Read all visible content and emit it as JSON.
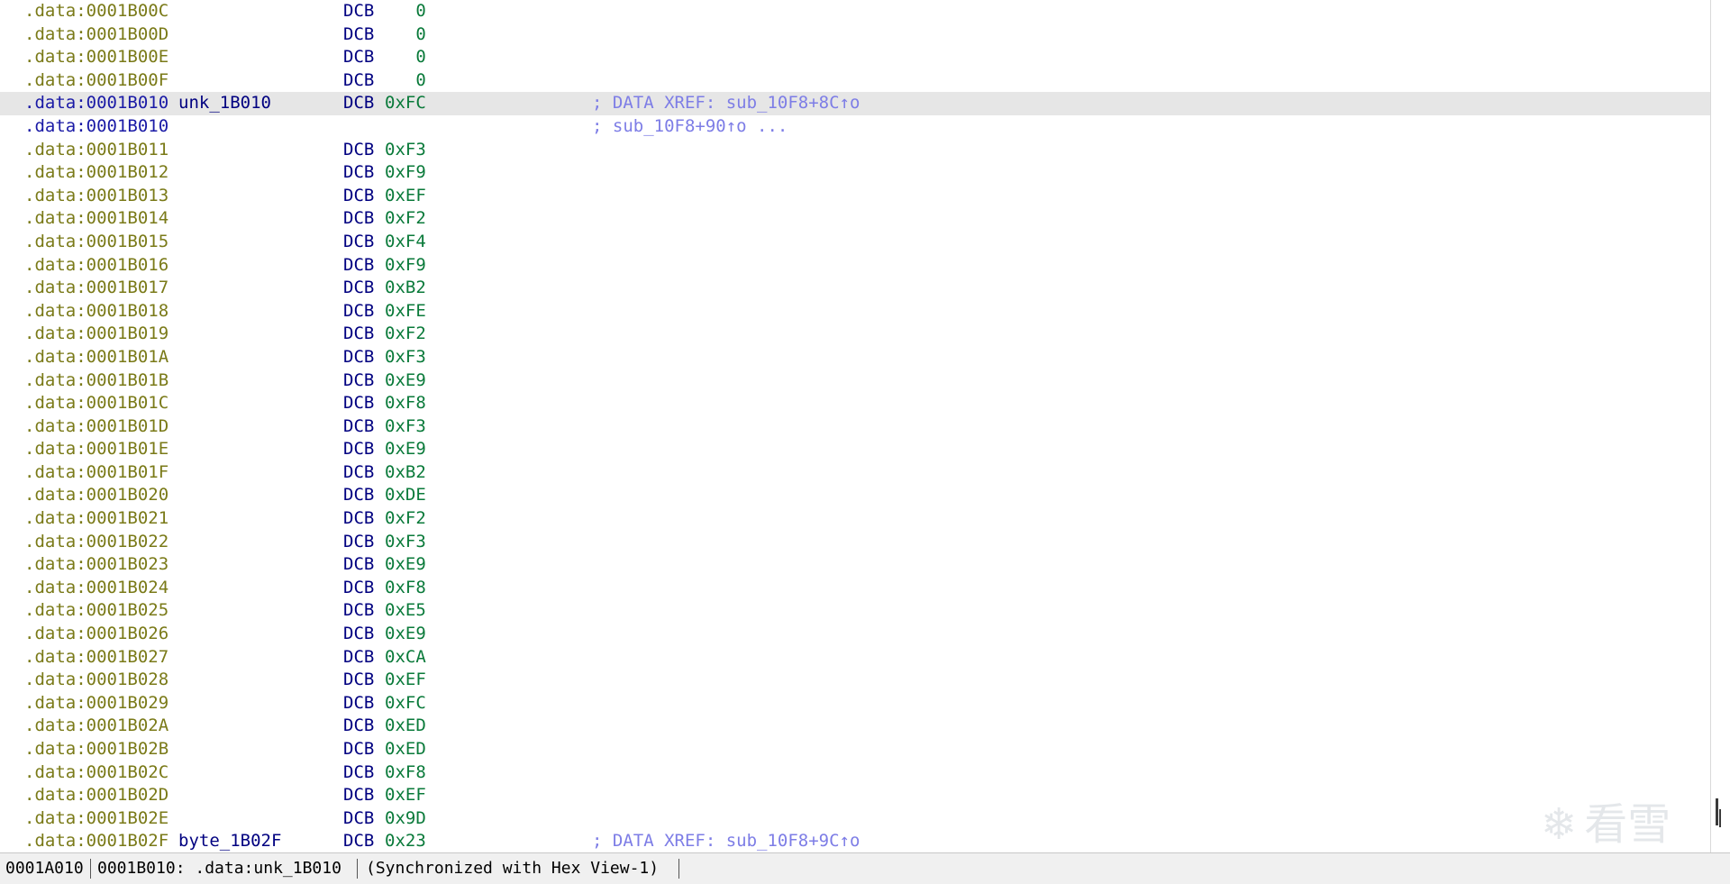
{
  "listing": {
    "rows": [
      {
        "addr": ".data:0001B00C",
        "label": "",
        "mnem": "DCB",
        "operand": "   0",
        "comment": "",
        "selected": false
      },
      {
        "addr": ".data:0001B00D",
        "label": "",
        "mnem": "DCB",
        "operand": "   0",
        "comment": "",
        "selected": false
      },
      {
        "addr": ".data:0001B00E",
        "label": "",
        "mnem": "DCB",
        "operand": "   0",
        "comment": "",
        "selected": false
      },
      {
        "addr": ".data:0001B00F",
        "label": "",
        "mnem": "DCB",
        "operand": "   0",
        "comment": "",
        "selected": false
      },
      {
        "addr": ".data:0001B010",
        "label": "unk_1B010",
        "mnem": "DCB",
        "operand": "0xFC",
        "comment": "; DATA XREF: sub_10F8+8C↑o",
        "selected": true
      },
      {
        "addr": ".data:0001B010",
        "label": "",
        "mnem": "",
        "operand": "",
        "comment": "; sub_10F8+90↑o ...",
        "selected": false,
        "xref_cont": true
      },
      {
        "addr": ".data:0001B011",
        "label": "",
        "mnem": "DCB",
        "operand": "0xF3",
        "comment": "",
        "selected": false
      },
      {
        "addr": ".data:0001B012",
        "label": "",
        "mnem": "DCB",
        "operand": "0xF9",
        "comment": "",
        "selected": false
      },
      {
        "addr": ".data:0001B013",
        "label": "",
        "mnem": "DCB",
        "operand": "0xEF",
        "comment": "",
        "selected": false
      },
      {
        "addr": ".data:0001B014",
        "label": "",
        "mnem": "DCB",
        "operand": "0xF2",
        "comment": "",
        "selected": false
      },
      {
        "addr": ".data:0001B015",
        "label": "",
        "mnem": "DCB",
        "operand": "0xF4",
        "comment": "",
        "selected": false
      },
      {
        "addr": ".data:0001B016",
        "label": "",
        "mnem": "DCB",
        "operand": "0xF9",
        "comment": "",
        "selected": false
      },
      {
        "addr": ".data:0001B017",
        "label": "",
        "mnem": "DCB",
        "operand": "0xB2",
        "comment": "",
        "selected": false
      },
      {
        "addr": ".data:0001B018",
        "label": "",
        "mnem": "DCB",
        "operand": "0xFE",
        "comment": "",
        "selected": false
      },
      {
        "addr": ".data:0001B019",
        "label": "",
        "mnem": "DCB",
        "operand": "0xF2",
        "comment": "",
        "selected": false
      },
      {
        "addr": ".data:0001B01A",
        "label": "",
        "mnem": "DCB",
        "operand": "0xF3",
        "comment": "",
        "selected": false
      },
      {
        "addr": ".data:0001B01B",
        "label": "",
        "mnem": "DCB",
        "operand": "0xE9",
        "comment": "",
        "selected": false
      },
      {
        "addr": ".data:0001B01C",
        "label": "",
        "mnem": "DCB",
        "operand": "0xF8",
        "comment": "",
        "selected": false
      },
      {
        "addr": ".data:0001B01D",
        "label": "",
        "mnem": "DCB",
        "operand": "0xF3",
        "comment": "",
        "selected": false
      },
      {
        "addr": ".data:0001B01E",
        "label": "",
        "mnem": "DCB",
        "operand": "0xE9",
        "comment": "",
        "selected": false
      },
      {
        "addr": ".data:0001B01F",
        "label": "",
        "mnem": "DCB",
        "operand": "0xB2",
        "comment": "",
        "selected": false
      },
      {
        "addr": ".data:0001B020",
        "label": "",
        "mnem": "DCB",
        "operand": "0xDE",
        "comment": "",
        "selected": false
      },
      {
        "addr": ".data:0001B021",
        "label": "",
        "mnem": "DCB",
        "operand": "0xF2",
        "comment": "",
        "selected": false
      },
      {
        "addr": ".data:0001B022",
        "label": "",
        "mnem": "DCB",
        "operand": "0xF3",
        "comment": "",
        "selected": false
      },
      {
        "addr": ".data:0001B023",
        "label": "",
        "mnem": "DCB",
        "operand": "0xE9",
        "comment": "",
        "selected": false
      },
      {
        "addr": ".data:0001B024",
        "label": "",
        "mnem": "DCB",
        "operand": "0xF8",
        "comment": "",
        "selected": false
      },
      {
        "addr": ".data:0001B025",
        "label": "",
        "mnem": "DCB",
        "operand": "0xE5",
        "comment": "",
        "selected": false
      },
      {
        "addr": ".data:0001B026",
        "label": "",
        "mnem": "DCB",
        "operand": "0xE9",
        "comment": "",
        "selected": false
      },
      {
        "addr": ".data:0001B027",
        "label": "",
        "mnem": "DCB",
        "operand": "0xCA",
        "comment": "",
        "selected": false
      },
      {
        "addr": ".data:0001B028",
        "label": "",
        "mnem": "DCB",
        "operand": "0xEF",
        "comment": "",
        "selected": false
      },
      {
        "addr": ".data:0001B029",
        "label": "",
        "mnem": "DCB",
        "operand": "0xFC",
        "comment": "",
        "selected": false
      },
      {
        "addr": ".data:0001B02A",
        "label": "",
        "mnem": "DCB",
        "operand": "0xED",
        "comment": "",
        "selected": false
      },
      {
        "addr": ".data:0001B02B",
        "label": "",
        "mnem": "DCB",
        "operand": "0xED",
        "comment": "",
        "selected": false
      },
      {
        "addr": ".data:0001B02C",
        "label": "",
        "mnem": "DCB",
        "operand": "0xF8",
        "comment": "",
        "selected": false
      },
      {
        "addr": ".data:0001B02D",
        "label": "",
        "mnem": "DCB",
        "operand": "0xEF",
        "comment": "",
        "selected": false
      },
      {
        "addr": ".data:0001B02E",
        "label": "",
        "mnem": "DCB",
        "operand": "0x9D",
        "comment": "",
        "selected": false
      },
      {
        "addr": ".data:0001B02F",
        "label": "byte_1B02F",
        "mnem": "DCB",
        "operand": "0x23",
        "comment": "; DATA XREF: sub_10F8+9C↑o",
        "selected": false
      }
    ]
  },
  "statusbar": {
    "file_offset": "0001A010",
    "location": "0001B010: .data:unk_1B010",
    "sync": "(Synchronized with Hex View-1)"
  },
  "watermark": {
    "text": "看雪",
    "icon": "snowflake-icon"
  },
  "colors": {
    "address": "#7a7a18",
    "address_selected": "#1a1aa6",
    "mnemonic": "#000080",
    "operand": "#0a7a3a",
    "comment": "#7d7de6",
    "selection_bg": "#e6e6e6"
  }
}
